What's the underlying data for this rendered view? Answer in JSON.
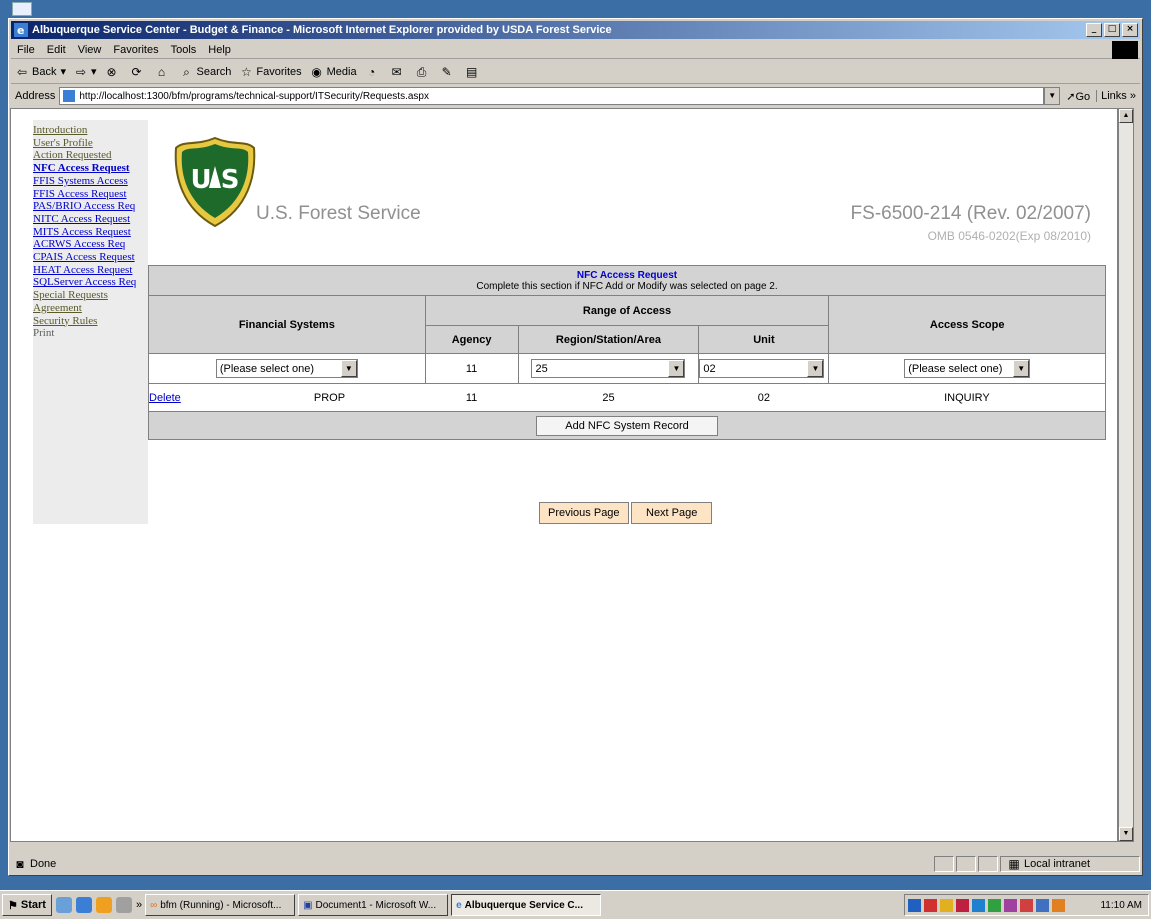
{
  "window": {
    "title": "Albuquerque Service Center - Budget & Finance - Microsoft Internet Explorer provided by USDA Forest Service",
    "controls": {
      "minimize": "_",
      "maximize": "□",
      "close": "×"
    }
  },
  "menubar": {
    "items": [
      "File",
      "Edit",
      "View",
      "Favorites",
      "Tools",
      "Help"
    ]
  },
  "toolbar": {
    "back": "Back",
    "search": "Search",
    "favorites": "Favorites",
    "media": "Media"
  },
  "address": {
    "label": "Address",
    "url": "http://localhost:1300/bfm/programs/technical-support/ITSecurity/Requests.aspx",
    "go": "Go",
    "links": "Links"
  },
  "nav": {
    "items": [
      {
        "label": "Introduction"
      },
      {
        "label": "User's Profile"
      },
      {
        "label": "Action Requested"
      },
      {
        "label": "NFC Access Request"
      },
      {
        "label": "FFIS Systems Access"
      },
      {
        "label": "FFIS Access Request"
      },
      {
        "label": "PAS/BRIO Access Req"
      },
      {
        "label": "NITC Access Request"
      },
      {
        "label": "MITS Access Request"
      },
      {
        "label": "ACRWS Access Req"
      },
      {
        "label": "CPAIS Access Request"
      },
      {
        "label": "HEAT Access Request"
      },
      {
        "label": "SQLServer Access Req"
      },
      {
        "label": "Special Requests"
      },
      {
        "label": "Agreement"
      },
      {
        "label": "Security Rules"
      },
      {
        "label": "Print"
      }
    ]
  },
  "header": {
    "agency": "U.S. Forest Service",
    "form_number": "FS-6500-214 (Rev. 02/2007)",
    "omb": "OMB 0546-0202(Exp 08/2010)",
    "logo_text": {
      "top": "FOREST SERVICE",
      "letters": "US",
      "bottom": "DEPARTMENT OF AGRICULTURE"
    }
  },
  "section": {
    "title": "NFC Access Request",
    "subtitle": "Complete this section if NFC Add or Modify was selected on page 2."
  },
  "table": {
    "headers": {
      "financial_systems": "Financial Systems",
      "range_of_access": "Range of Access",
      "agency": "Agency",
      "region": "Region/Station/Area",
      "unit": "Unit",
      "access_scope": "Access Scope"
    },
    "input_row": {
      "financial_system": "(Please select one)",
      "agency": "11",
      "region": "25",
      "unit": "02",
      "access_scope": "(Please select one)"
    },
    "records": [
      {
        "delete": "Delete",
        "system": "PROP",
        "agency": "11",
        "region": "25",
        "unit": "02",
        "scope": "INQUIRY"
      }
    ],
    "add_button": "Add NFC System Record"
  },
  "pager": {
    "previous": "Previous Page",
    "next": "Next Page"
  },
  "status": {
    "text": "Done",
    "zone": "Local intranet"
  },
  "taskbar": {
    "start": "Start",
    "chevron": "»",
    "tasks": [
      "bfm (Running) - Microsoft...",
      "Document1 - Microsoft W...",
      "Albuquerque Service C..."
    ],
    "clock": "11:10 AM"
  }
}
